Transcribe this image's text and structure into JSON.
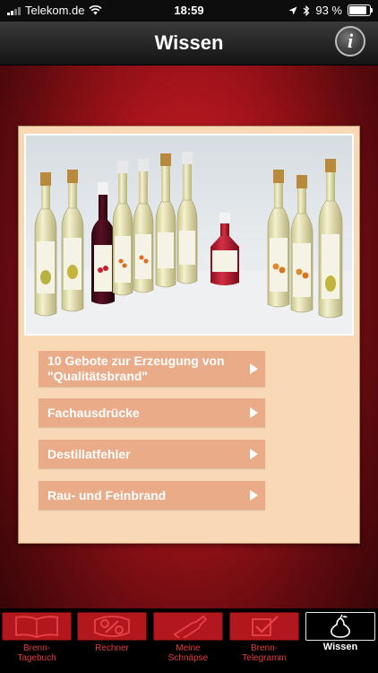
{
  "status_bar": {
    "carrier": "Telekom.de",
    "time": "18:59",
    "battery": "93 %"
  },
  "nav": {
    "title": "Wissen",
    "info_label": "i"
  },
  "menu": [
    {
      "label_line1": "10 Gebote zur Erzeugung von",
      "label_line2": "\"Qualitätsbrand\""
    },
    {
      "label": "Fachausdrücke"
    },
    {
      "label": "Destillatfehler"
    },
    {
      "label": "Rau- und Feinbrand"
    }
  ],
  "tabs": [
    {
      "label_line1": "Brenn-",
      "label_line2": "Tagebuch",
      "icon": "book-icon",
      "active": false
    },
    {
      "label_line1": "Rechner",
      "label_line2": "",
      "icon": "percent-icon",
      "active": false
    },
    {
      "label_line1": "Meine",
      "label_line2": "Schnäpse",
      "icon": "bottle-icon",
      "active": false
    },
    {
      "label_line1": "Brenn-",
      "label_line2": "Telegramm",
      "icon": "checkbox-icon",
      "active": false
    },
    {
      "label_line1": "Wissen",
      "label_line2": "",
      "icon": "pear-icon",
      "active": true
    }
  ],
  "colors": {
    "background_red": "#d6232a",
    "panel": "#f9d9b5",
    "menu_button": "#e9ab88",
    "tab_tile": "#b2171d"
  }
}
